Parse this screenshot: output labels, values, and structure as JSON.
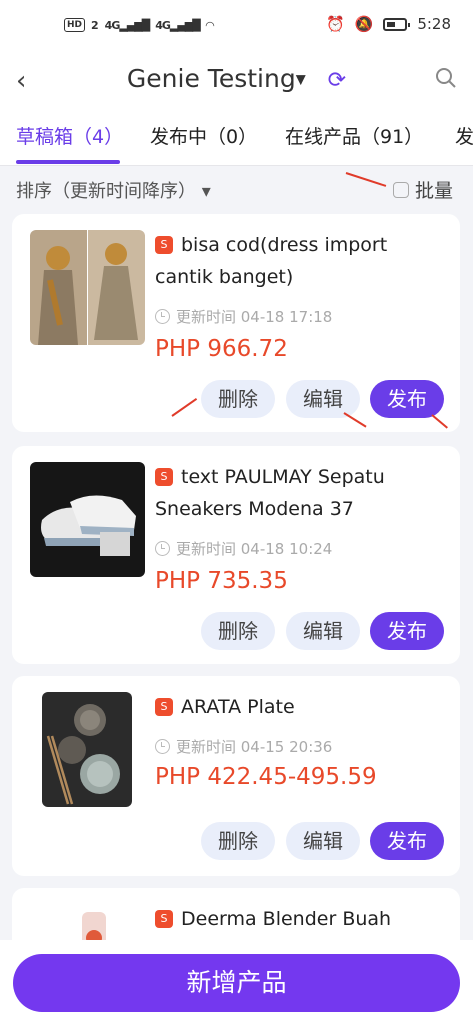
{
  "status_bar": {
    "hd": "HD",
    "sim": "2",
    "signal1": "4G",
    "signal2": "4G",
    "time": "5:28"
  },
  "header": {
    "title": "Genie Testing"
  },
  "tabs": [
    {
      "label": "草稿箱（4）",
      "active": true
    },
    {
      "label": "发布中（0）",
      "active": false
    },
    {
      "label": "在线产品（91）",
      "active": false
    },
    {
      "label": "发",
      "active": false
    }
  ],
  "sort": {
    "label": "排序（更新时间降序）",
    "batch_label": "批量"
  },
  "products": [
    {
      "name": "bisa cod(dress import cantik banget)",
      "time": "更新时间 04-18 17:18",
      "price": "PHP 966.72",
      "delete_label": "删除",
      "edit_label": "编辑",
      "publish_label": "发布"
    },
    {
      "name": "text PAULMAY Sepatu Sneakers Modena 37",
      "time": "更新时间 04-18 10:24",
      "price": "PHP 735.35",
      "delete_label": "删除",
      "edit_label": "编辑",
      "publish_label": "发布"
    },
    {
      "name": "ARATA Plate",
      "time": "更新时间 04-15 20:36",
      "price": "PHP 422.45-495.59",
      "delete_label": "删除",
      "edit_label": "编辑",
      "publish_label": "发布"
    },
    {
      "name": "Deerma Blender Buah"
    }
  ],
  "footer": {
    "add_label": "新增产品"
  },
  "colors": {
    "accent": "#6a3de8",
    "price": "#e8492a",
    "shop": "#ee4d2d"
  }
}
